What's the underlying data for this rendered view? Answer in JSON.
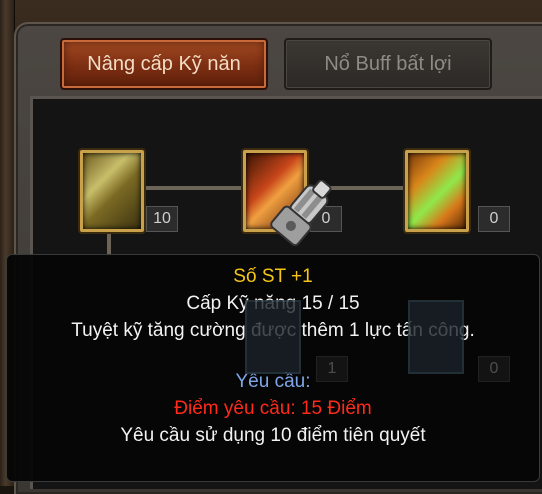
{
  "tabs": {
    "active": "Nâng cấp Kỹ năn",
    "inactive": "Nổ Buff bất lợi"
  },
  "skills": [
    {
      "level": "10",
      "icon": "golden-warrior-icon"
    },
    {
      "level": "0",
      "icon": "flame-slash-icon"
    },
    {
      "level": "0",
      "icon": "green-star-burst-icon"
    }
  ],
  "faded_levels": [
    "1",
    "0"
  ],
  "tooltip": {
    "title": "Số ST +1",
    "skill_level": "Cấp Kỹ năng 15 / 15",
    "description": "Tuyệt kỹ tăng cường được thêm 1 lực tấn công.",
    "requirements_header": "Yêu cầu:",
    "required_points": "Điểm yêu cầu: 15 Điểm",
    "prerequisite": "Yêu cầu sử dụng 10 điểm tiên quyết"
  },
  "colors": {
    "title": "#f5c518",
    "requirement_header": "#7fa6e8",
    "requirement_points": "#ff2a1a",
    "active_tab": "#8a3616"
  }
}
